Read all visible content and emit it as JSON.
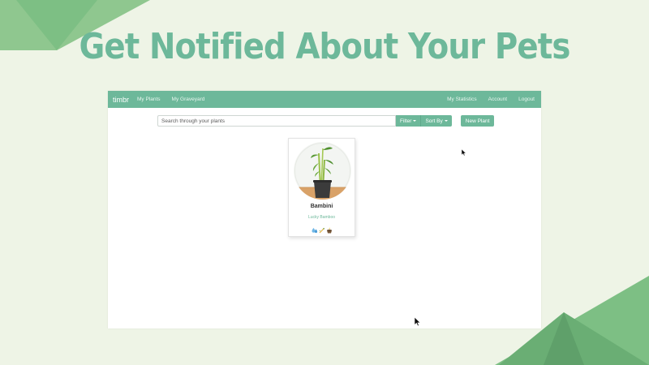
{
  "headline": "Get Notified About Your Pets",
  "navbar": {
    "brand": "timbr",
    "links_left": [
      "My Plants",
      "My Graveyard"
    ],
    "links_right": [
      "My Statistics",
      "Account",
      "Logout"
    ]
  },
  "toolbar": {
    "search_placeholder": "Search through your plants",
    "filter_label": "Filter",
    "sort_label": "Sort By",
    "new_plant_label": "New Plant"
  },
  "plants": [
    {
      "name": "Bambini",
      "species": "Lucky Bamboo",
      "care_icons": [
        "water-drop-icon",
        "sunlight-icon",
        "soil-pot-icon"
      ]
    }
  ],
  "colors": {
    "accent": "#6db89a",
    "background": "#eef4e6",
    "decoration": "#7dbf84"
  }
}
